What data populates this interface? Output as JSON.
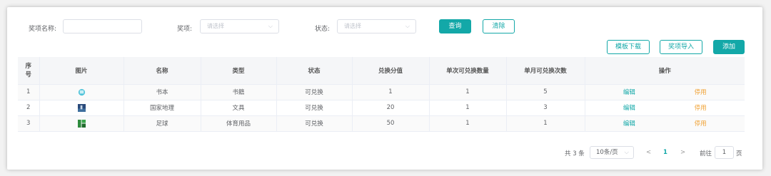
{
  "filters": {
    "prize_name_label": "奖项名称:",
    "prize_name_value": "",
    "prize_label": "奖项:",
    "prize_placeholder": "请选择",
    "status_label": "状态:",
    "status_placeholder": "请选择"
  },
  "actions": {
    "query": "查询",
    "clear": "清除",
    "template_download": "模板下载",
    "prize_import": "奖项导入",
    "add": "添加"
  },
  "table": {
    "headers": [
      "序号",
      "图片",
      "名称",
      "类型",
      "状态",
      "兑换分值",
      "单次可兑换数量",
      "单月可兑换次数",
      "操作"
    ],
    "edit_label": "编辑",
    "disable_label": "停用",
    "rows": [
      {
        "index": "1",
        "image": "book-thumbnail",
        "name": "书本",
        "type": "书籍",
        "status": "可兑换",
        "points": "1",
        "per_time": "1",
        "per_month": "5"
      },
      {
        "index": "2",
        "image": "geography-thumbnail",
        "name": "国家地理",
        "type": "文具",
        "status": "可兑换",
        "points": "20",
        "per_time": "1",
        "per_month": "3"
      },
      {
        "index": "3",
        "image": "football-thumbnail",
        "name": "足球",
        "type": "体育用品",
        "status": "可兑换",
        "points": "50",
        "per_time": "1",
        "per_month": "1"
      }
    ]
  },
  "pagination": {
    "total": "共 3 条",
    "page_size": "10条/页",
    "prev": "<",
    "current_page": "1",
    "next": ">",
    "goto_label": "前往",
    "goto_value": "1",
    "page_unit": "页"
  },
  "colors": {
    "accent": "#13a8a8",
    "warning_link": "#f0a030",
    "header_bg": "#f5f6f8"
  }
}
